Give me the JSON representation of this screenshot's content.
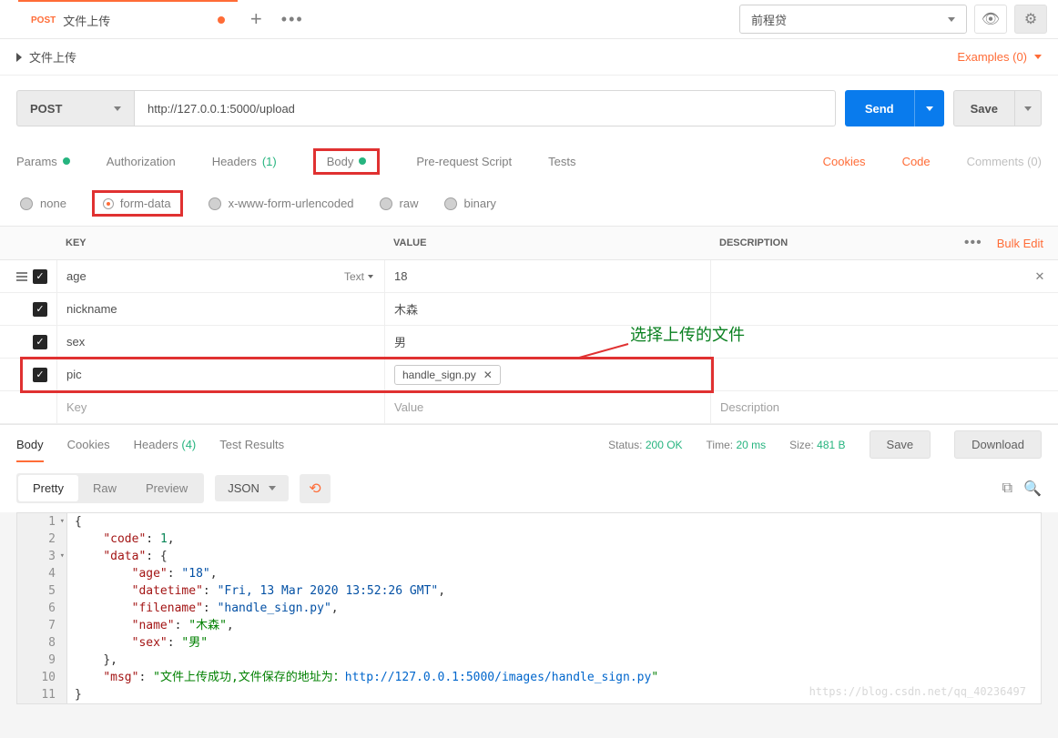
{
  "tab": {
    "method": "POST",
    "title": "文件上传"
  },
  "env": {
    "name": "前程贷"
  },
  "collapse": {
    "title": "文件上传",
    "examples": "Examples (0)"
  },
  "request": {
    "method": "POST",
    "url": "http://127.0.0.1:5000/upload",
    "send": "Send",
    "save": "Save"
  },
  "reqTabs": {
    "params": "Params",
    "authorization": "Authorization",
    "headers": "Headers",
    "headersCount": "(1)",
    "body": "Body",
    "prerequest": "Pre-request Script",
    "tests": "Tests",
    "cookies": "Cookies",
    "code": "Code",
    "comments": "Comments (0)"
  },
  "bodyTypes": {
    "none": "none",
    "formdata": "form-data",
    "xwww": "x-www-form-urlencoded",
    "raw": "raw",
    "binary": "binary"
  },
  "kv": {
    "headers": {
      "key": "KEY",
      "value": "VALUE",
      "description": "DESCRIPTION",
      "bulk": "Bulk Edit"
    },
    "rows": [
      {
        "key": "age",
        "type": "Text",
        "value": "18"
      },
      {
        "key": "nickname",
        "value": "木森"
      },
      {
        "key": "sex",
        "value": "男"
      },
      {
        "key": "pic",
        "file": "handle_sign.py"
      }
    ],
    "placeholder": {
      "key": "Key",
      "value": "Value",
      "description": "Description"
    }
  },
  "annotation": "选择上传的文件",
  "respTabs": {
    "body": "Body",
    "cookies": "Cookies",
    "headers": "Headers",
    "headersCount": "(4)",
    "testResults": "Test Results",
    "statusLabel": "Status:",
    "statusValue": "200 OK",
    "timeLabel": "Time:",
    "timeValue": "20 ms",
    "sizeLabel": "Size:",
    "sizeValue": "481 B",
    "save": "Save",
    "download": "Download"
  },
  "viewRow": {
    "pretty": "Pretty",
    "raw": "Raw",
    "preview": "Preview",
    "type": "JSON"
  },
  "response": {
    "code": 1,
    "age": "18",
    "datetime": "Fri, 13 Mar 2020 13:52:26 GMT",
    "filename": "handle_sign.py",
    "name": "木森",
    "sex": "男",
    "msgPrefix": "文件上传成功,文件保存的地址为：",
    "msgUrl": "http://127.0.0.1:5000/images/handle_sign.py"
  },
  "watermark": "https://blog.csdn.net/qq_40236497"
}
